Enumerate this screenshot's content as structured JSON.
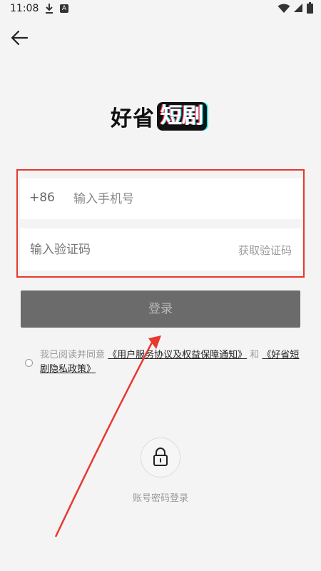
{
  "status_bar": {
    "time": "11:08",
    "icons": [
      "download-icon",
      "a-notification-icon",
      "wifi-icon",
      "signal-icon",
      "battery-icon"
    ],
    "a_icon_text": "A"
  },
  "header": {
    "back_icon": "back-arrow-icon"
  },
  "logo": {
    "part1": "好省",
    "part2": "短剧"
  },
  "form": {
    "country_code": "+86",
    "phone_placeholder": "输入手机号",
    "code_placeholder": "输入验证码",
    "get_code_label": "获取验证码"
  },
  "login": {
    "label": "登录"
  },
  "agreement": {
    "prefix": "我已阅读并同意 ",
    "link1": "《用户服务协议及权益保障通知》",
    "connector": " 和 ",
    "link2": "《好省短剧隐私政策》"
  },
  "alt_login": {
    "icon": "lock-icon",
    "label": "账号密码登录"
  },
  "colors": {
    "highlight_red": "#e8382f",
    "login_button_bg": "#6b6b6b",
    "background": "#f4f4f4"
  }
}
